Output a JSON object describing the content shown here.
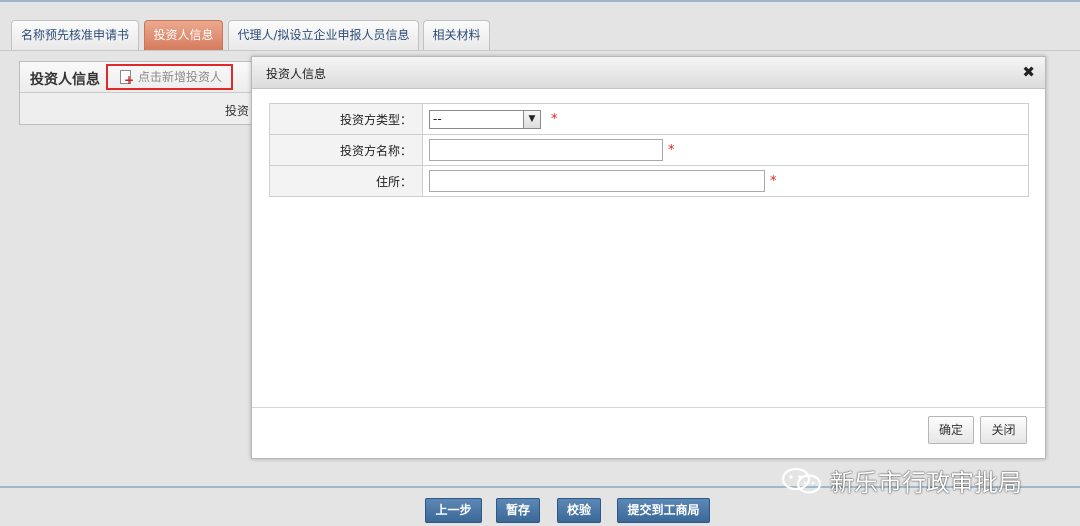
{
  "tabs": [
    {
      "label": "名称预先核准申请书",
      "active": false
    },
    {
      "label": "投资人信息",
      "active": true
    },
    {
      "label": "代理人/拟设立企业申报人员信息",
      "active": false
    },
    {
      "label": "相关材料",
      "active": false
    }
  ],
  "panel": {
    "title": "投资人信息",
    "add_button": "点击新增投资人",
    "column_header": "投资"
  },
  "dialog": {
    "title": "投资人信息",
    "close_icon": "✖",
    "fields": [
      {
        "label": "投资方类型：",
        "type": "select",
        "value": "--",
        "required": "*"
      },
      {
        "label": "投资方名称：",
        "type": "text",
        "value": "",
        "required": "*"
      },
      {
        "label": "住所：",
        "type": "text",
        "value": "",
        "required": "*"
      }
    ],
    "confirm": "确定",
    "close": "关闭"
  },
  "bottom": {
    "prev": "上一步",
    "save": "暂存",
    "check": "校验",
    "submit": "提交到工商局"
  },
  "watermark": "新乐市行政审批局",
  "colors": {
    "active_tab": "#d5795b",
    "primary_button": "#3a6897",
    "required": "#e02020",
    "highlight_border": "#e02a2a"
  }
}
